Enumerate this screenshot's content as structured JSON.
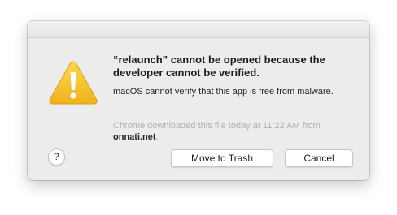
{
  "dialog": {
    "title": "“relaunch” cannot be opened because the developer cannot be verified.",
    "message": "macOS cannot verify that this app is free from malware.",
    "source_prefix": "Chrome downloaded this file today at 11:22 AM from",
    "source_domain": "onnati.net",
    "source_suffix": ".",
    "icon": "warning-triangle-icon",
    "help_label": "?",
    "buttons": {
      "move_to_trash": "Move to Trash",
      "cancel": "Cancel"
    }
  },
  "colors": {
    "dialog_background": "#ececec",
    "warning_fill": "#f5c025",
    "source_text": "#b0b0b0"
  }
}
